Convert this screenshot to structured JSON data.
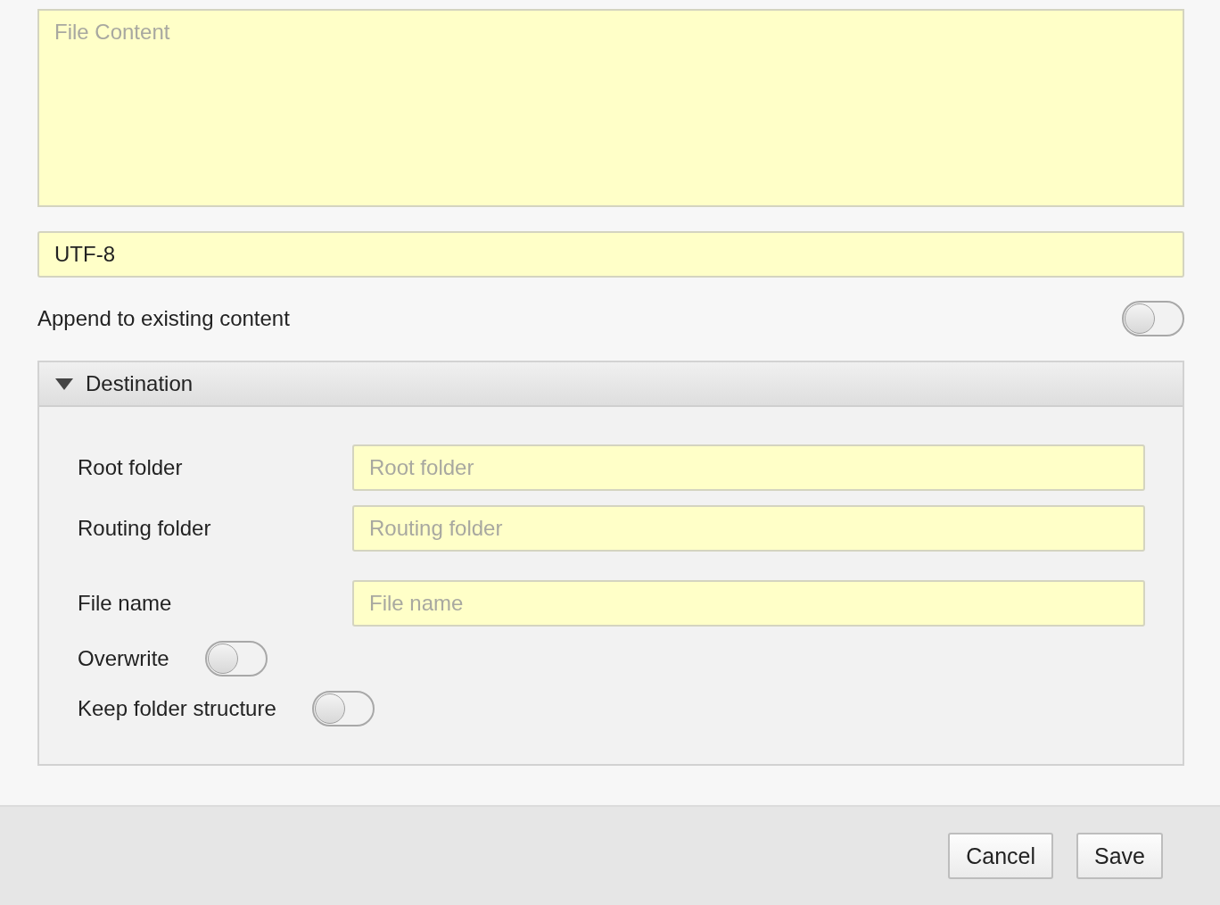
{
  "file_content": {
    "placeholder": "File Content"
  },
  "encoding": {
    "value": "UTF-8"
  },
  "append": {
    "label": "Append to existing content",
    "on": false
  },
  "destination": {
    "title": "Destination",
    "expanded": true,
    "fields": [
      {
        "label": "Root folder",
        "placeholder": "Root folder"
      },
      {
        "label": "Routing folder",
        "placeholder": "Routing folder"
      },
      {
        "label": "File name",
        "placeholder": "File name"
      }
    ],
    "toggles": [
      {
        "label": "Overwrite",
        "on": false
      },
      {
        "label": "Keep folder structure",
        "on": false
      }
    ]
  },
  "buttons": [
    {
      "label": "Cancel"
    },
    {
      "label": "Save"
    }
  ]
}
